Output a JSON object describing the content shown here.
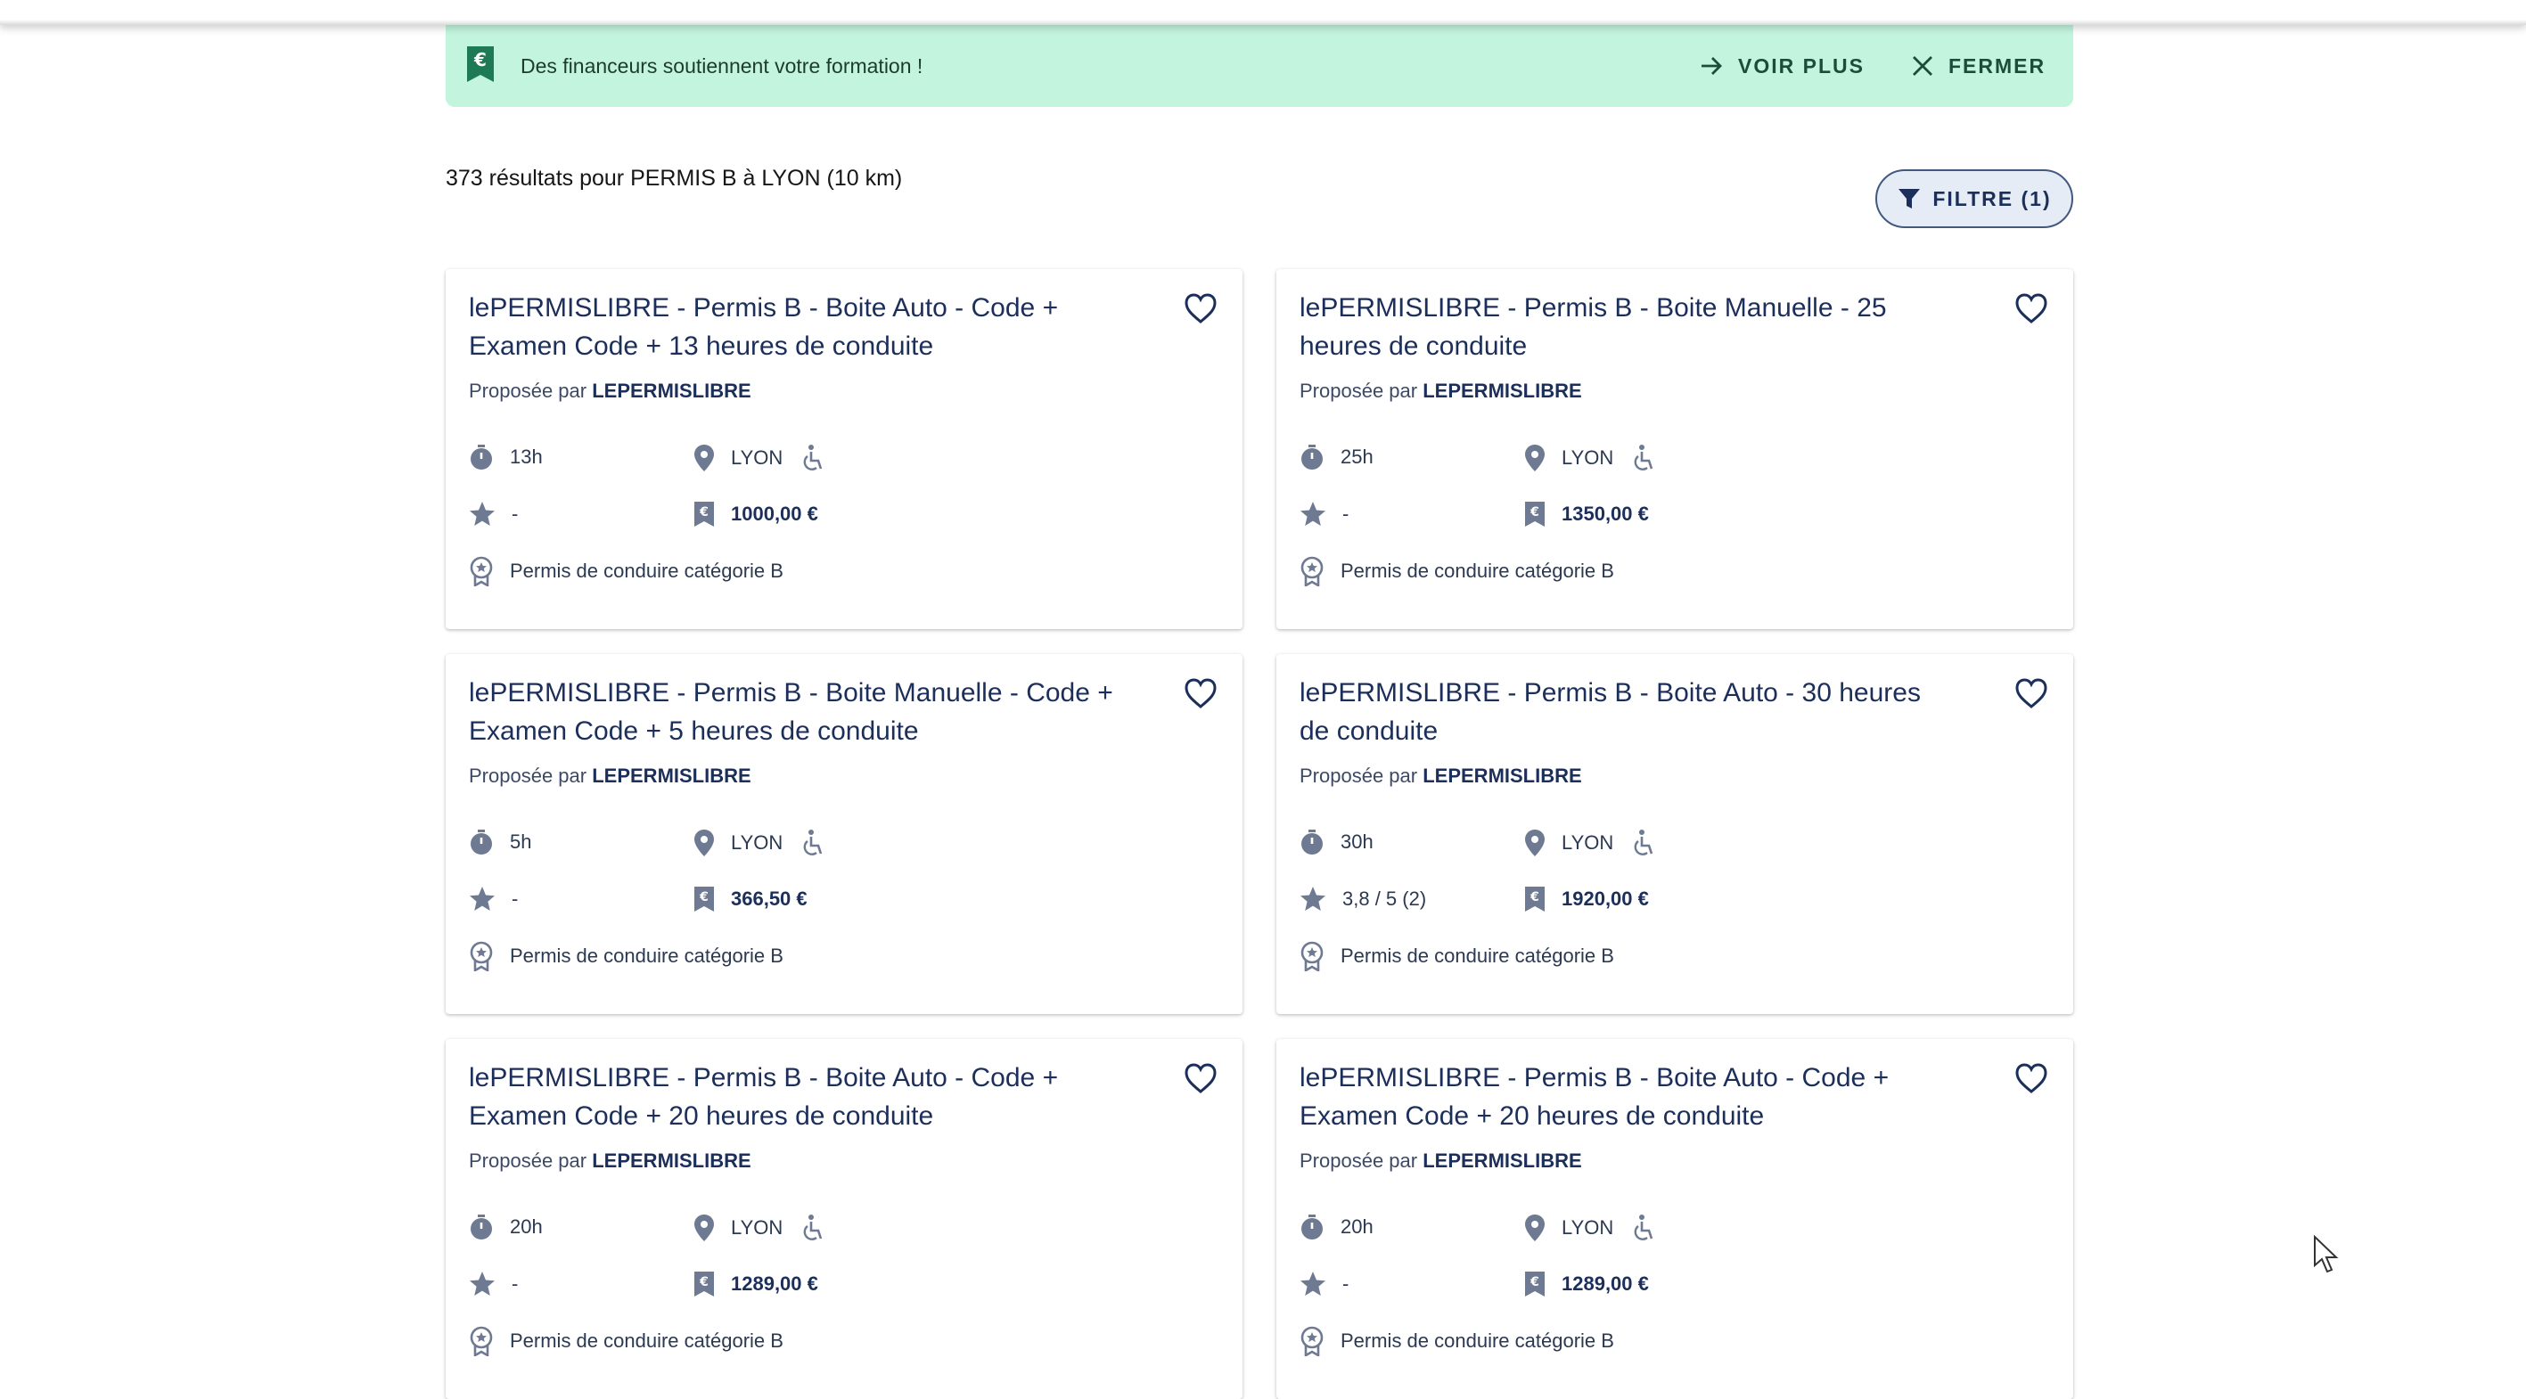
{
  "banner": {
    "text": "Des financeurs soutiennent votre formation !",
    "voir_plus": "VOIR PLUS",
    "fermer": "FERMER"
  },
  "results": {
    "summary": "373 résultats pour PERMIS B à LYON (10 km)",
    "filter_label": "FILTRE (1)"
  },
  "provider_prefix": "Proposée par",
  "cards": [
    {
      "title": "lePERMISLIBRE - Permis B - Boite Auto - Code + Examen Code + 13 heures de conduite",
      "provider": "LEPERMISLIBRE",
      "duration": "13h",
      "location": "LYON",
      "rating": "-",
      "price": "1000,00 €",
      "certification": "Permis de conduire catégorie B"
    },
    {
      "title": "lePERMISLIBRE - Permis B - Boite Manuelle - 25 heures de conduite",
      "provider": "LEPERMISLIBRE",
      "duration": "25h",
      "location": "LYON",
      "rating": "-",
      "price": "1350,00 €",
      "certification": "Permis de conduire catégorie B"
    },
    {
      "title": "lePERMISLIBRE - Permis B - Boite Manuelle - Code + Examen Code + 5 heures de conduite",
      "provider": "LEPERMISLIBRE",
      "duration": "5h",
      "location": "LYON",
      "rating": "-",
      "price": "366,50 €",
      "certification": "Permis de conduire catégorie B"
    },
    {
      "title": "lePERMISLIBRE - Permis B - Boite Auto - 30 heures de conduite",
      "provider": "LEPERMISLIBRE",
      "duration": "30h",
      "location": "LYON",
      "rating": "3,8 / 5 (2)",
      "price": "1920,00 €",
      "certification": "Permis de conduire catégorie B"
    },
    {
      "title": "lePERMISLIBRE - Permis B - Boite Auto - Code + Examen Code + 20 heures de conduite",
      "provider": "LEPERMISLIBRE",
      "duration": "20h",
      "location": "LYON",
      "rating": "-",
      "price": "1289,00 €",
      "certification": "Permis de conduire catégorie B"
    },
    {
      "title": "lePERMISLIBRE - Permis B - Boite Auto - Code + Examen Code + 20 heures de conduite",
      "provider": "LEPERMISLIBRE",
      "duration": "20h",
      "location": "LYON",
      "rating": "-",
      "price": "1289,00 €",
      "certification": "Permis de conduire catégorie B"
    }
  ],
  "colors": {
    "banner_bg": "#c3f5de",
    "primary": "#1c2f5b",
    "icon_grey": "#6e7a91",
    "filter_bg": "#e6ecf6"
  }
}
